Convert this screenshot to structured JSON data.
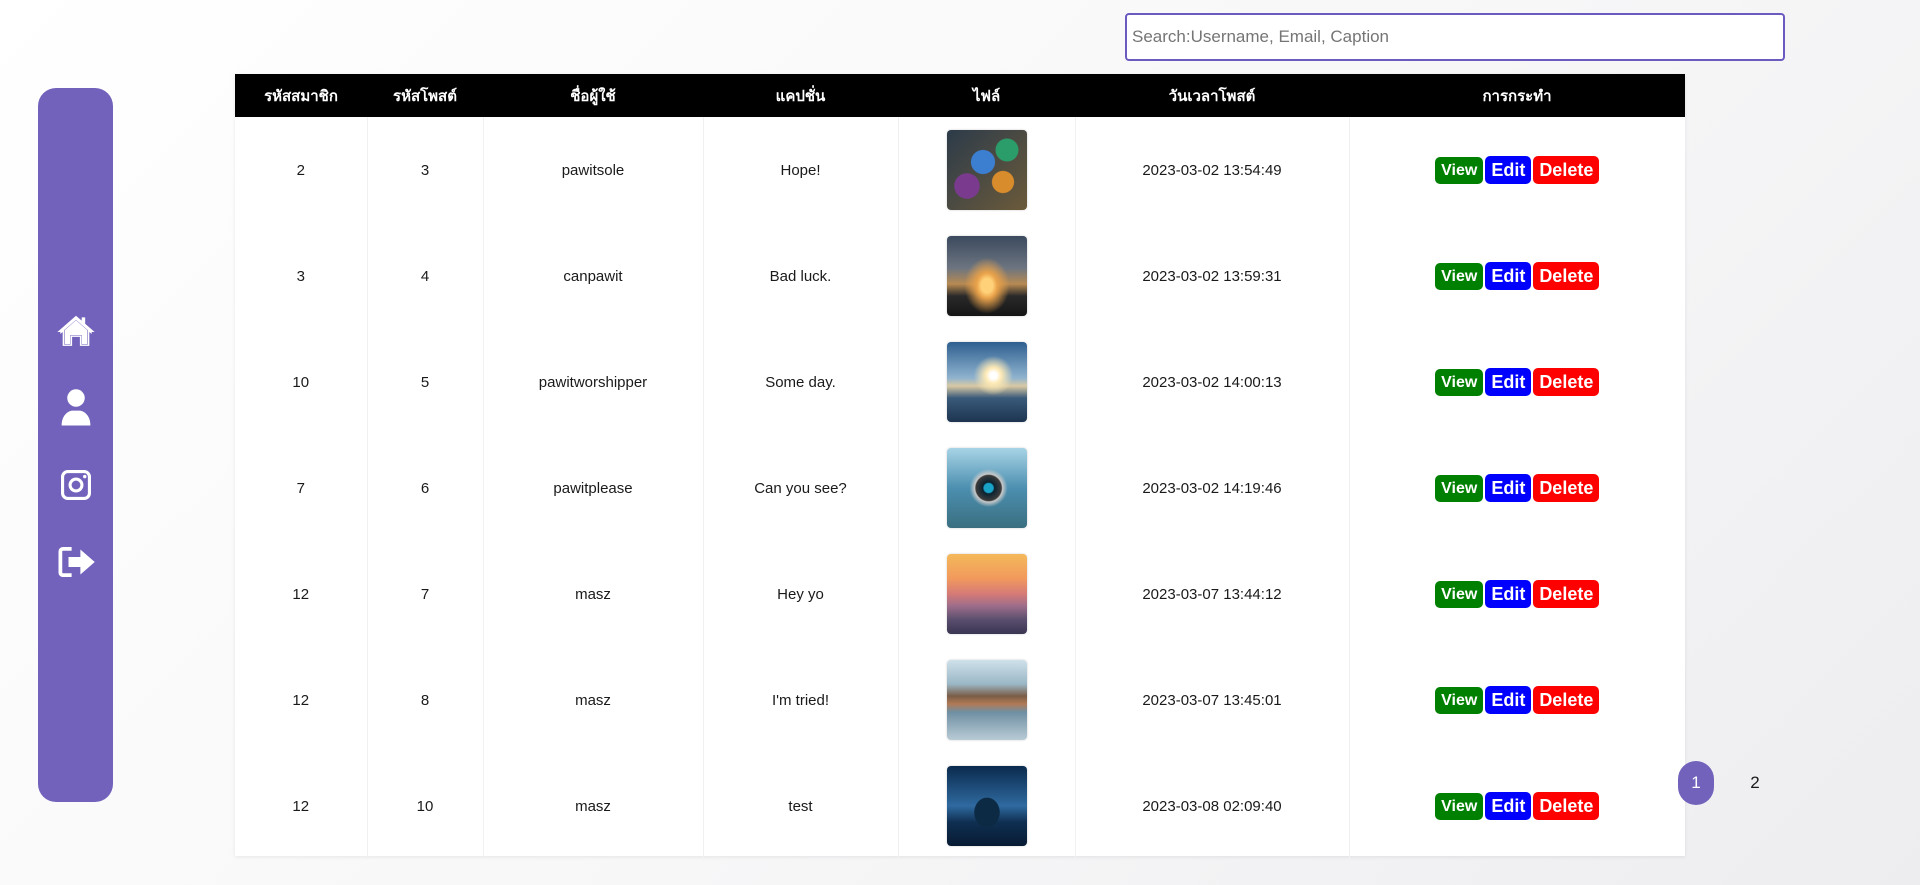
{
  "search": {
    "placeholder": "Search:Username, Email, Caption",
    "value": ""
  },
  "sidebar": {
    "icons": [
      "home-icon",
      "user-icon",
      "instagram-icon",
      "sign-out-icon"
    ],
    "color": "#7262bb"
  },
  "table": {
    "headers": [
      "รหัสสมาชิก",
      "รหัสโพสต์",
      "ชื่อผู้ใช้",
      "แคปชั่น",
      "ไฟล์",
      "วันเวลาโพสต์",
      "การกระทำ"
    ],
    "rows": [
      {
        "member_id": "2",
        "post_id": "3",
        "username": "pawitsole",
        "caption": "Hope!",
        "image": "graffiti-stones-photo",
        "datetime": "2023-03-02 13:54:49"
      },
      {
        "member_id": "3",
        "post_id": "4",
        "username": "canpawit",
        "caption": "Bad luck.",
        "image": "sunset-silhouette-photo",
        "datetime": "2023-03-02 13:59:31"
      },
      {
        "member_id": "10",
        "post_id": "5",
        "username": "pawitworshipper",
        "caption": "Some day.",
        "image": "hand-at-lake-photo",
        "datetime": "2023-03-02 14:00:13"
      },
      {
        "member_id": "7",
        "post_id": "6",
        "username": "pawitplease",
        "caption": "Can you see?",
        "image": "lens-in-hand-photo",
        "datetime": "2023-03-02 14:19:46"
      },
      {
        "member_id": "12",
        "post_id": "7",
        "username": "masz",
        "caption": "Hey yo",
        "image": "mountain-haze-photo",
        "datetime": "2023-03-07 13:44:12"
      },
      {
        "member_id": "12",
        "post_id": "8",
        "username": "masz",
        "caption": "I'm tried!",
        "image": "coastal-village-photo",
        "datetime": "2023-03-07 13:45:01"
      },
      {
        "member_id": "12",
        "post_id": "10",
        "username": "masz",
        "caption": "test",
        "image": "night-mountain-photo",
        "datetime": "2023-03-08 02:09:40"
      }
    ],
    "actions": {
      "view": "View",
      "edit": "Edit",
      "delete": "Delete"
    },
    "colors": {
      "view": "#008000",
      "edit": "#0000ff",
      "delete": "#ff0000",
      "header": "#000000"
    }
  },
  "pagination": {
    "pages": [
      "1",
      "2"
    ],
    "active": "1"
  }
}
